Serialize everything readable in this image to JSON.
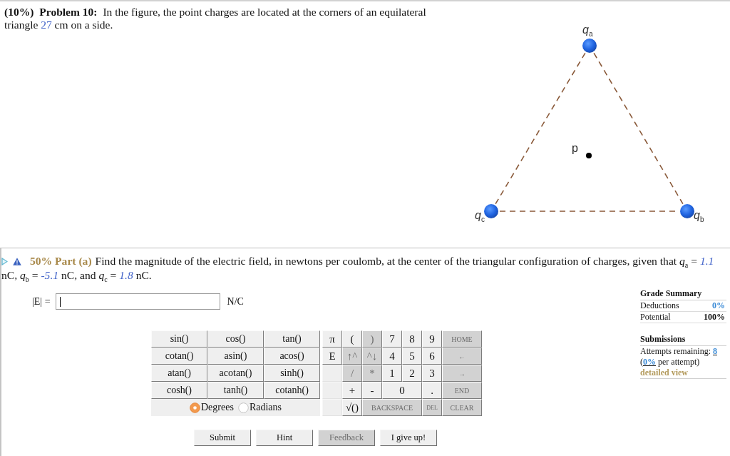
{
  "problem": {
    "weight": "(10%)",
    "title": "Problem 10:",
    "statement": [
      {
        "kind": "text",
        "text": "In the figure, the point charges are located at the corners of an equilateral triangle "
      },
      {
        "kind": "number",
        "text": "27"
      },
      {
        "kind": "text",
        "text": " cm on a side."
      }
    ],
    "figure": {
      "charges": [
        {
          "label": "*q*$_{a}$"
        },
        {
          "label": "*q*$_{b}$"
        },
        {
          "label": "*q*$_{c}$"
        }
      ],
      "point": {
        "label": "p"
      }
    }
  },
  "part": {
    "title": "50% Part (a)",
    "question": [
      {
        "kind": "text",
        "text": "Find the magnitude of the electric field, in newtons per coulomb, at the center of the triangular configuration of charges, given that *q*$_{a}$ = "
      },
      {
        "kind": "variable",
        "text": "1.1"
      },
      {
        "kind": "text",
        "text": " nC, *q*$_{b}$ = "
      },
      {
        "kind": "variable",
        "text": "-5.1"
      },
      {
        "kind": "text",
        "text": " nC, and *q*$_{c}$ = "
      },
      {
        "kind": "variable",
        "text": "1.8"
      },
      {
        "kind": "text",
        "text": " nC."
      }
    ],
    "answer": {
      "label": "|E| =",
      "unit": "N/C"
    },
    "calculator": {
      "functions": [
        [
          "sin()",
          "cos()",
          "tan()"
        ],
        [
          "cotan()",
          "asin()",
          "acos()"
        ],
        [
          "atan()",
          "acotan()",
          "sinh()"
        ],
        [
          "cosh()",
          "tanh()",
          "cotanh()"
        ]
      ],
      "angle_modes": [
        {
          "label": "Degrees",
          "selected": true
        },
        {
          "label": "Radians",
          "selected": false
        }
      ],
      "keypad": [
        [
          {
            "kind": "key",
            "label": "π",
            "wide": false,
            "disabled": false
          },
          {
            "kind": "key",
            "label": "(",
            "wide": false,
            "disabled": false
          },
          {
            "kind": "key",
            "label": ")",
            "wide": false,
            "disabled": true
          },
          {
            "kind": "key",
            "label": "7",
            "wide": false,
            "disabled": false
          },
          {
            "kind": "key",
            "label": "8",
            "wide": false,
            "disabled": false
          },
          {
            "kind": "key",
            "label": "9",
            "wide": false,
            "disabled": false
          },
          {
            "kind": "command",
            "label": "HOME",
            "wide": false,
            "disabled": true
          }
        ],
        [
          {
            "kind": "key",
            "label": "E",
            "wide": false,
            "disabled": false
          },
          {
            "kind": "key",
            "label": "↑^",
            "wide": false,
            "disabled": true
          },
          {
            "kind": "key",
            "label": "^↓",
            "wide": false,
            "disabled": true
          },
          {
            "kind": "key",
            "label": "4",
            "wide": false,
            "disabled": false
          },
          {
            "kind": "key",
            "label": "5",
            "wide": false,
            "disabled": false
          },
          {
            "kind": "key",
            "label": "6",
            "wide": false,
            "disabled": false
          },
          {
            "kind": "command",
            "label": "←",
            "wide": false,
            "disabled": true
          }
        ],
        [
          {
            "kind": "blank"
          },
          {
            "kind": "key",
            "label": "/",
            "wide": false,
            "disabled": true
          },
          {
            "kind": "key",
            "label": "*",
            "wide": false,
            "disabled": true
          },
          {
            "kind": "key",
            "label": "1",
            "wide": false,
            "disabled": false
          },
          {
            "kind": "key",
            "label": "2",
            "wide": false,
            "disabled": false
          },
          {
            "kind": "key",
            "label": "3",
            "wide": false,
            "disabled": false
          },
          {
            "kind": "command",
            "label": "→",
            "wide": false,
            "disabled": true
          }
        ],
        [
          {
            "kind": "blank"
          },
          {
            "kind": "key",
            "label": "+",
            "wide": false,
            "disabled": false
          },
          {
            "kind": "key",
            "label": "-",
            "wide": false,
            "disabled": false
          },
          {
            "kind": "key",
            "label": "0",
            "wide": true,
            "disabled": false
          },
          {
            "kind": "key",
            "label": ".",
            "wide": false,
            "disabled": false
          },
          {
            "kind": "command",
            "label": "END",
            "wide": false,
            "disabled": true
          }
        ],
        [
          {
            "kind": "blank"
          },
          {
            "kind": "key",
            "label": "√()",
            "wide": false,
            "disabled": false
          },
          {
            "kind": "command",
            "label": "BACKSPACE",
            "wide": true,
            "disabled": true
          },
          {
            "kind": "command",
            "label": "DEL",
            "wide": false,
            "disabled": true
          },
          {
            "kind": "command",
            "label": "CLEAR",
            "wide": false,
            "disabled": true
          }
        ]
      ]
    },
    "buttons": [
      {
        "label": "Submit",
        "disabled": false
      },
      {
        "label": "Hint",
        "disabled": false
      },
      {
        "label": "Feedback",
        "disabled": true
      },
      {
        "label": "I give up!",
        "disabled": false
      }
    ],
    "grade_summary": {
      "title": "Grade Summary",
      "rows": [
        {
          "label": "Deductions",
          "value": "0%",
          "kind": "link"
        },
        {
          "label": "Potential",
          "value": "100%",
          "kind": "total"
        }
      ]
    },
    "submissions": {
      "title": "Submissions",
      "attempts": [
        {
          "kind": "text",
          "text": "Attempts remaining: "
        },
        {
          "kind": "link",
          "text": "8"
        }
      ],
      "penalty": [
        {
          "kind": "text",
          "text": "("
        },
        {
          "kind": "link",
          "text": "0%"
        },
        {
          "kind": "text",
          "text": " per attempt)"
        }
      ],
      "details": "detailed view"
    }
  }
}
